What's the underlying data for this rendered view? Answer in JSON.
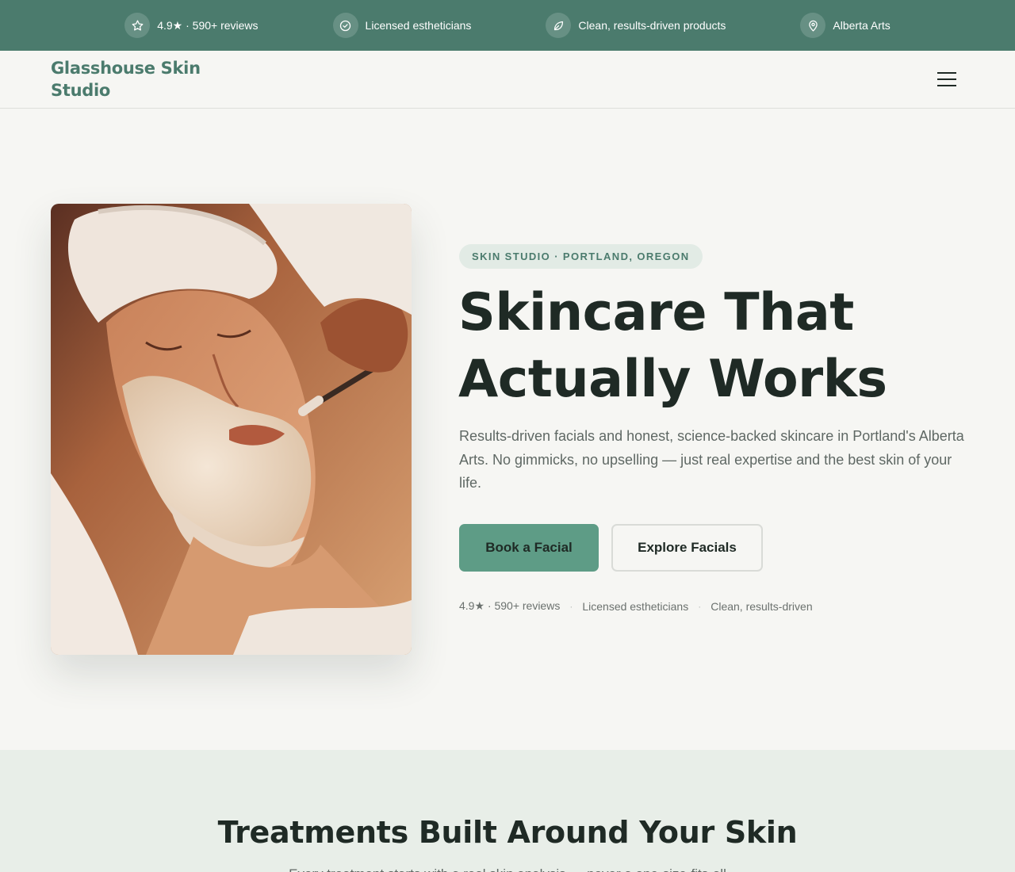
{
  "colors": {
    "brand_green": "#4b7b6d",
    "button_green": "#5e9c86",
    "page_bg": "#f6f6f3",
    "section_bg": "#e8eee8",
    "heading": "#1f2a25"
  },
  "topbar": {
    "items": [
      {
        "icon": "star-icon",
        "label": "4.9★ · 590+ reviews"
      },
      {
        "icon": "check-circle-icon",
        "label": "Licensed estheticians"
      },
      {
        "icon": "leaf-icon",
        "label": "Clean, results-driven products"
      },
      {
        "icon": "map-pin-icon",
        "label": "Alberta Arts"
      }
    ]
  },
  "header": {
    "brand": "Glasshouse Skin Studio",
    "menu_icon": "hamburger-menu-icon"
  },
  "hero": {
    "eyebrow": "SKIN STUDIO · PORTLAND, OREGON",
    "title_line1": "Skincare That",
    "title_line2": "Actually Works",
    "description": "Results-driven facials and honest, science-backed skincare in Portland's Alberta Arts. No gimmicks, no upselling — just real expertise and the best skin of your life.",
    "primary_cta": "Book a Facial",
    "secondary_cta": "Explore Facials",
    "proof": [
      "4.9★ · 590+ reviews",
      "Licensed estheticians",
      "Clean, results-driven"
    ],
    "proof_separator": "·"
  },
  "treatments": {
    "title": "Treatments Built Around Your Skin",
    "subtitle": "Every treatment starts with a real skin analysis — never a one-size-fits-all"
  }
}
